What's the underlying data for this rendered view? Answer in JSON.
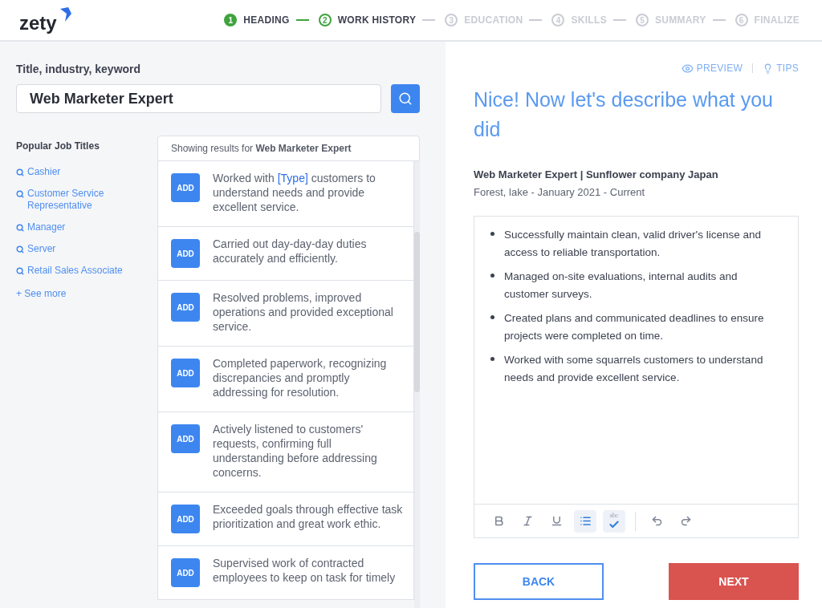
{
  "logo": "zety",
  "steps": [
    {
      "number": "1",
      "label": "HEADING",
      "done": true,
      "selected": false
    },
    {
      "number": "2",
      "label": "WORK HISTORY",
      "done": false,
      "selected": true
    },
    {
      "number": "3",
      "label": "EDUCATION",
      "done": false,
      "selected": false
    },
    {
      "number": "4",
      "label": "SKILLS",
      "done": false,
      "selected": false
    },
    {
      "number": "5",
      "label": "SUMMARY",
      "done": false,
      "selected": false
    },
    {
      "number": "6",
      "label": "FINALIZE",
      "done": false,
      "selected": false
    }
  ],
  "search": {
    "label": "Title, industry, keyword",
    "value": "Web Marketer Expert"
  },
  "popular": {
    "title": "Popular Job Titles",
    "items": [
      "Cashier",
      "Customer Service Representative",
      "Manager",
      "Server",
      "Retail Sales Associate"
    ],
    "more": "+ See more"
  },
  "results": {
    "header": "Showing results for **Web Marketer Expert**",
    "items": [
      {
        "add_label": "ADD",
        "parts": [
          {
            "kind": "plain",
            "text": "Worked with "
          },
          {
            "kind": "token",
            "text": "[Type]"
          },
          {
            "kind": "plain",
            "text": " customers to understand needs and provide excellent service."
          }
        ]
      },
      {
        "add_label": "ADD",
        "parts": [
          {
            "kind": "plain",
            "text": "Carried out day-day-day duties accurately and efficiently."
          }
        ]
      },
      {
        "add_label": "ADD",
        "parts": [
          {
            "kind": "plain",
            "text": "Resolved problems, improved operations and provided exceptional service."
          }
        ]
      },
      {
        "add_label": "ADD",
        "parts": [
          {
            "kind": "plain",
            "text": "Completed paperwork, recognizing discrepancies and promptly addressing for resolution."
          }
        ]
      },
      {
        "add_label": "ADD",
        "parts": [
          {
            "kind": "plain",
            "text": "Actively listened to customers' requests, confirming full understanding before addressing concerns."
          }
        ]
      },
      {
        "add_label": "ADD",
        "parts": [
          {
            "kind": "plain",
            "text": "Exceeded goals through effective task prioritization and great work ethic."
          }
        ]
      },
      {
        "add_label": "ADD",
        "parts": [
          {
            "kind": "plain",
            "text": "Supervised work of contracted employees to keep on task for timely"
          }
        ]
      }
    ]
  },
  "links": [
    {
      "kind": "preview",
      "label": "PREVIEW"
    },
    {
      "kind": "tips",
      "label": "TIPS"
    }
  ],
  "heading": "Nice! Now let's describe what you did",
  "job": {
    "title": "Web Marketer Expert | Sunflower company Japan",
    "details": "Forest, lake - January 2021 - Current"
  },
  "editor": {
    "bullets": [
      "Successfully maintain clean, valid driver's license and access to reliable transportation.",
      "Managed on-site evaluations, internal audits and customer surveys.",
      "Created plans and communicated deadlines to ensure projects were completed on time.",
      "Worked with some squarrels customers to understand needs and provide excellent service."
    ],
    "tools": [
      {
        "kind": "bold",
        "active": false
      },
      {
        "kind": "italic",
        "active": false
      },
      {
        "kind": "underline",
        "active": false
      },
      {
        "kind": "list",
        "active": true
      },
      {
        "kind": "spellcheck",
        "active": true,
        "text": "abc"
      },
      {
        "kind": "undo",
        "active": false
      },
      {
        "kind": "redo",
        "active": false
      }
    ]
  },
  "buttons": {
    "back": "BACK",
    "next": "NEXT"
  }
}
